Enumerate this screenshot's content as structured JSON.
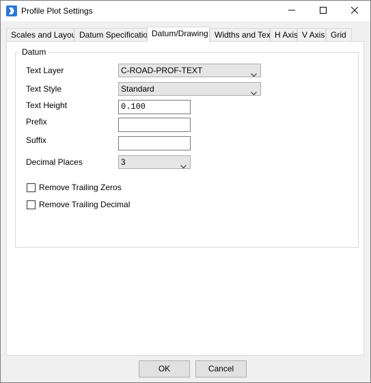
{
  "window": {
    "title": "Profile Plot Settings"
  },
  "tabs": [
    {
      "label": "Scales and Layout"
    },
    {
      "label": "Datum Specification"
    },
    {
      "label": "Datum/Drawing"
    },
    {
      "label": "Widths and Text"
    },
    {
      "label": "H Axis"
    },
    {
      "label": "V Axis"
    },
    {
      "label": "Grid"
    }
  ],
  "active_tab": "Datum/Drawing",
  "datum": {
    "group_label": "Datum",
    "text_layer": {
      "label": "Text Layer",
      "value": "C-ROAD-PROF-TEXT"
    },
    "text_style": {
      "label": "Text Style",
      "value": "Standard"
    },
    "text_height": {
      "label": "Text Height",
      "value": "0.100"
    },
    "prefix": {
      "label": "Prefix",
      "value": ""
    },
    "suffix": {
      "label": "Suffix",
      "value": ""
    },
    "decimal_places": {
      "label": "Decimal Places",
      "value": "3"
    },
    "remove_trailing_zeros": {
      "label": "Remove Trailing Zeros",
      "checked": false
    },
    "remove_trailing_decimal": {
      "label": "Remove Trailing Decimal",
      "checked": false
    }
  },
  "buttons": {
    "ok": "OK",
    "cancel": "Cancel"
  },
  "icons": {
    "app": "bricscad-app-icon",
    "minimize": "minimize-icon",
    "maximize": "maximize-icon",
    "close": "close-icon",
    "dropdown": "chevron-down-icon"
  },
  "colors": {
    "accent": "#2b79d6",
    "tab_panel_bg": "#ffffff",
    "window_bg": "#f0f0f0"
  }
}
